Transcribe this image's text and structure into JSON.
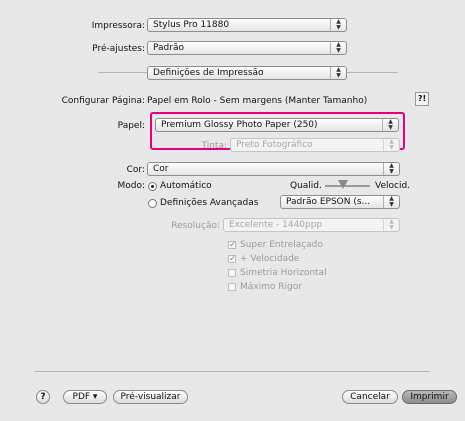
{
  "printer": {
    "label": "Impressora:",
    "value": "Stylus Pro 11880"
  },
  "presets": {
    "label": "Pré-ajustes:",
    "value": "Padrão"
  },
  "panel": {
    "value": "Definições de Impressão"
  },
  "page_setup": {
    "label": "Configurar Página:",
    "value": "Papel em Rolo - Sem margens (Manter Tamanho)"
  },
  "paper": {
    "label": "Papel:",
    "value": "Premium Glossy Photo Paper (250)"
  },
  "ink": {
    "label": "Tinta:",
    "value": "Preto Fotográfico"
  },
  "color": {
    "label": "Cor:",
    "value": "Cor"
  },
  "mode": {
    "label": "Modo:",
    "automatic": "Automático",
    "quality": "Qualid.",
    "speed": "Velocid.",
    "slider_level": 0.4,
    "advanced": "Definições Avançadas",
    "advanced_value": "Padrão EPSON (s..."
  },
  "resolution": {
    "label": "Resolução:",
    "value": "Excelente - 1440ppp"
  },
  "options": [
    {
      "label": "Super Entrelaçado",
      "checked": true
    },
    {
      "label": "+ Velocidade",
      "checked": true
    },
    {
      "label": "Simetria Horizontal",
      "checked": false
    },
    {
      "label": "Máximo Rigor",
      "checked": false
    }
  ],
  "footer": {
    "help": "?",
    "pdf": "PDF ▾",
    "preview": "Pré-visualizar",
    "cancel": "Cancelar",
    "print": "Imprimir"
  },
  "colors": {
    "highlight": "#e6007e"
  }
}
